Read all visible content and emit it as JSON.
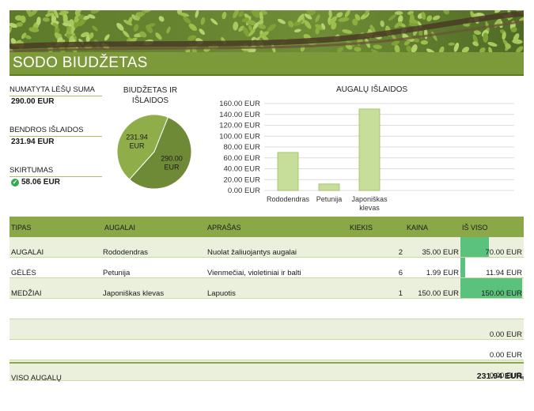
{
  "header": {
    "title": "SODO BIUDŽETAS"
  },
  "summary": {
    "planned_label": "NUMATYTA LĖŠŲ SUMA",
    "planned_value": "290.00 EUR",
    "total_label": "BENDROS IŠLAIDOS",
    "total_value": "231.94 EUR",
    "diff_label": "SKIRTUMAS",
    "diff_value": "58.06 EUR"
  },
  "colors": {
    "title_bar": "#7d9a3a",
    "header_row": "#8aa848",
    "pie_light": "#8fae4a",
    "pie_dark": "#6f8a36",
    "bar_fill": "#c7dd9a",
    "data_bar": "#5bc27d"
  },
  "chart_data": [
    {
      "type": "pie",
      "title_line1": "BIUDŽETAS IR",
      "title_line2": "IŠLAIDOS",
      "slices": [
        {
          "label_line1": "231.94",
          "label_line2": "EUR",
          "value": 231.94
        },
        {
          "label_line1": "290.00",
          "label_line2": "EUR",
          "value": 290.0
        }
      ]
    },
    {
      "type": "bar",
      "title": "AUGALŲ IŠLAIDOS",
      "categories": [
        "Rododendras",
        "Petunija",
        "Japoniškas klevas"
      ],
      "category_lines": [
        [
          "Rododendras"
        ],
        [
          "Petunija"
        ],
        [
          "Japoniškas",
          "klevas"
        ]
      ],
      "values": [
        70.0,
        11.94,
        150.0
      ],
      "ylim": [
        0,
        160
      ],
      "yticks": [
        "0.00 EUR",
        "20.00 EUR",
        "40.00 EUR",
        "60.00 EUR",
        "80.00 EUR",
        "100.00 EUR",
        "120.00 EUR",
        "140.00 EUR",
        "160.00 EUR"
      ],
      "grid": true
    }
  ],
  "table": {
    "headers": {
      "type": "TIPAS",
      "plants": "AUGALAI",
      "desc": "APRAŠAS",
      "qty": "KIEKIS",
      "price": "KAINA",
      "total": "IŠ VISO"
    },
    "rows": [
      {
        "type": "AUGALAI",
        "plant": "Rododendras",
        "desc": "Nuolat žaliuojantys augalai",
        "qty": "2",
        "price": "35.00 EUR",
        "total": "70.00 EUR",
        "total_num": 70.0
      },
      {
        "type": "GĖLĖS",
        "plant": "Petunija",
        "desc": "Vienmečiai, violetiniai ir balti",
        "qty": "6",
        "price": "1.99 EUR",
        "total": "11.94 EUR",
        "total_num": 11.94
      },
      {
        "type": "MEDŽIAI",
        "plant": "Japoniškas klevas",
        "desc": "Lapuotis",
        "qty": "1",
        "price": "150.00 EUR",
        "total": "150.00 EUR",
        "total_num": 150.0
      },
      {
        "type": "",
        "plant": "",
        "desc": "",
        "qty": "",
        "price": "",
        "total": "",
        "total_num": 0
      },
      {
        "type": "",
        "plant": "",
        "desc": "",
        "qty": "",
        "price": "",
        "total": "0.00 EUR",
        "total_num": 0
      },
      {
        "type": "",
        "plant": "",
        "desc": "",
        "qty": "",
        "price": "",
        "total": "0.00 EUR",
        "total_num": 0
      },
      {
        "type": "",
        "plant": "",
        "desc": "",
        "qty": "",
        "price": "",
        "total": "0.00 EUR",
        "total_num": 0
      }
    ],
    "footer_label": "VISO AUGALŲ",
    "footer_value": "231.94 EUR"
  }
}
